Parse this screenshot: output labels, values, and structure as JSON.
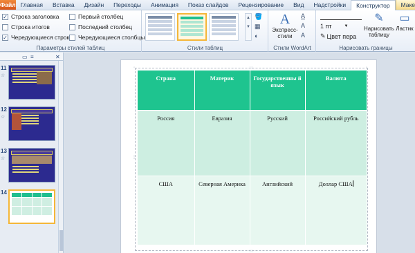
{
  "tabs": [
    "Файл",
    "Главная",
    "Вставка",
    "Дизайн",
    "Переходы",
    "Анимация",
    "Показ слайдов",
    "Рецензирование",
    "Вид",
    "Надстройки",
    "Конструктор",
    "Макет"
  ],
  "ribbon": {
    "style_options": {
      "header_row": "Строка заголовка",
      "total_row": "Строка итогов",
      "banded_rows": "Чередующиеся строки",
      "first_column": "Первый столбец",
      "last_column": "Последний столбец",
      "banded_columns": "Чередующиеся столбцы",
      "group_label": "Параметры стилей таблиц"
    },
    "table_styles_label": "Стили таблиц",
    "wordart": {
      "quick_styles_line1": "Экспресс-",
      "quick_styles_line2": "стили",
      "group_label": "Стили WordArt"
    },
    "borders": {
      "pen_weight": "1 пт",
      "pen_color": "Цвет пера",
      "draw_table_line1": "Нарисовать",
      "draw_table_line2": "таблицу",
      "eraser": "Ластик",
      "group_label": "Нарисовать границы"
    }
  },
  "slides": [
    {
      "number": "11"
    },
    {
      "number": "12"
    },
    {
      "number": "13"
    },
    {
      "number": "14"
    }
  ],
  "table": {
    "headers": [
      "Страна",
      "Материк",
      "Государственны й язык",
      "Валюта"
    ],
    "rows": [
      [
        "Россия",
        "Евразия",
        "Русский",
        "Российский рубль"
      ],
      [
        "США",
        "Северная Америка",
        "Английский",
        "Доллар США"
      ]
    ]
  },
  "colors": {
    "accent_header": "#1ec48f",
    "row_band": "#cdeee1",
    "row_light": "#e7f7f0"
  }
}
